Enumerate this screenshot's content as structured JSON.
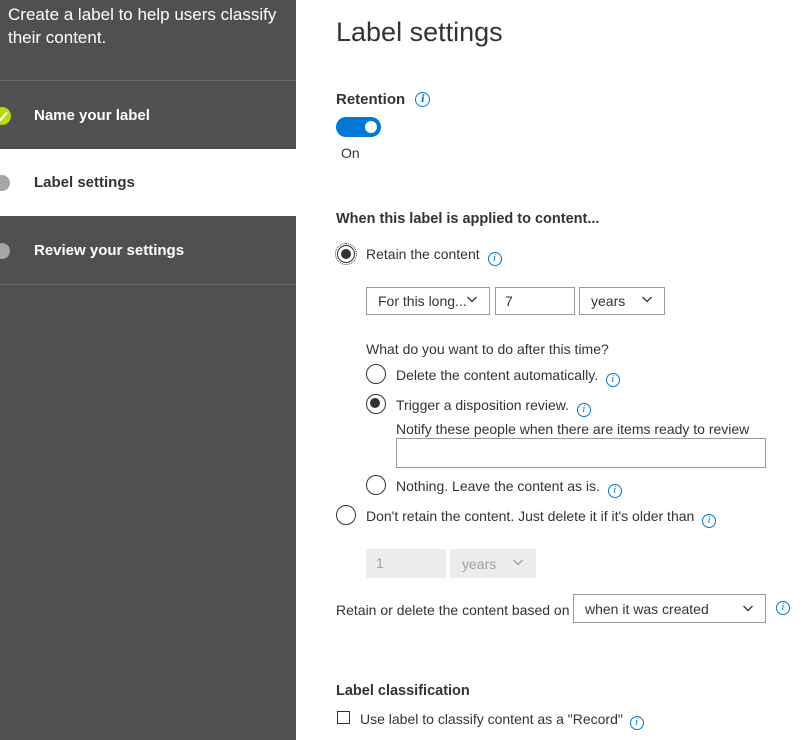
{
  "sidebar": {
    "intro": "Create a label to help users classify their content.",
    "steps": [
      {
        "label": "Name your label",
        "state": "complete"
      },
      {
        "label": "Label settings",
        "state": "current"
      },
      {
        "label": "Review your settings",
        "state": "pending"
      }
    ]
  },
  "page": {
    "title": "Label settings"
  },
  "retention": {
    "label": "Retention",
    "toggle_on": true,
    "toggle_state_text": "On"
  },
  "applied": {
    "heading": "When this label is applied to content...",
    "retain_label": "Retain the content",
    "retain_selected": true,
    "period_dropdown": "For this long...",
    "period_value": "7",
    "period_unit": "years",
    "after_question": "What do you want to do after this time?",
    "after_options": [
      {
        "label": "Delete the content automatically.",
        "selected": false
      },
      {
        "label": "Trigger a disposition review.",
        "selected": true
      },
      {
        "label": "Nothing. Leave the content as is.",
        "selected": false
      }
    ],
    "notify_label": "Notify these people when there are items ready to review",
    "notify_value": "",
    "dont_retain_label": "Don't retain the content. Just delete it if it's older than",
    "dont_retain_selected": false,
    "delete_value": "1",
    "delete_unit": "years",
    "based_on_label": "Retain or delete the content based on",
    "based_on_value": "when it was created"
  },
  "classification": {
    "heading": "Label classification",
    "record_label": "Use label to classify content as a \"Record\"",
    "record_checked": false
  },
  "colors": {
    "sidebar_bg": "#505050",
    "accent": "#0078d4",
    "complete_green": "#bad80a",
    "pending_dot": "#a6a6a6"
  }
}
